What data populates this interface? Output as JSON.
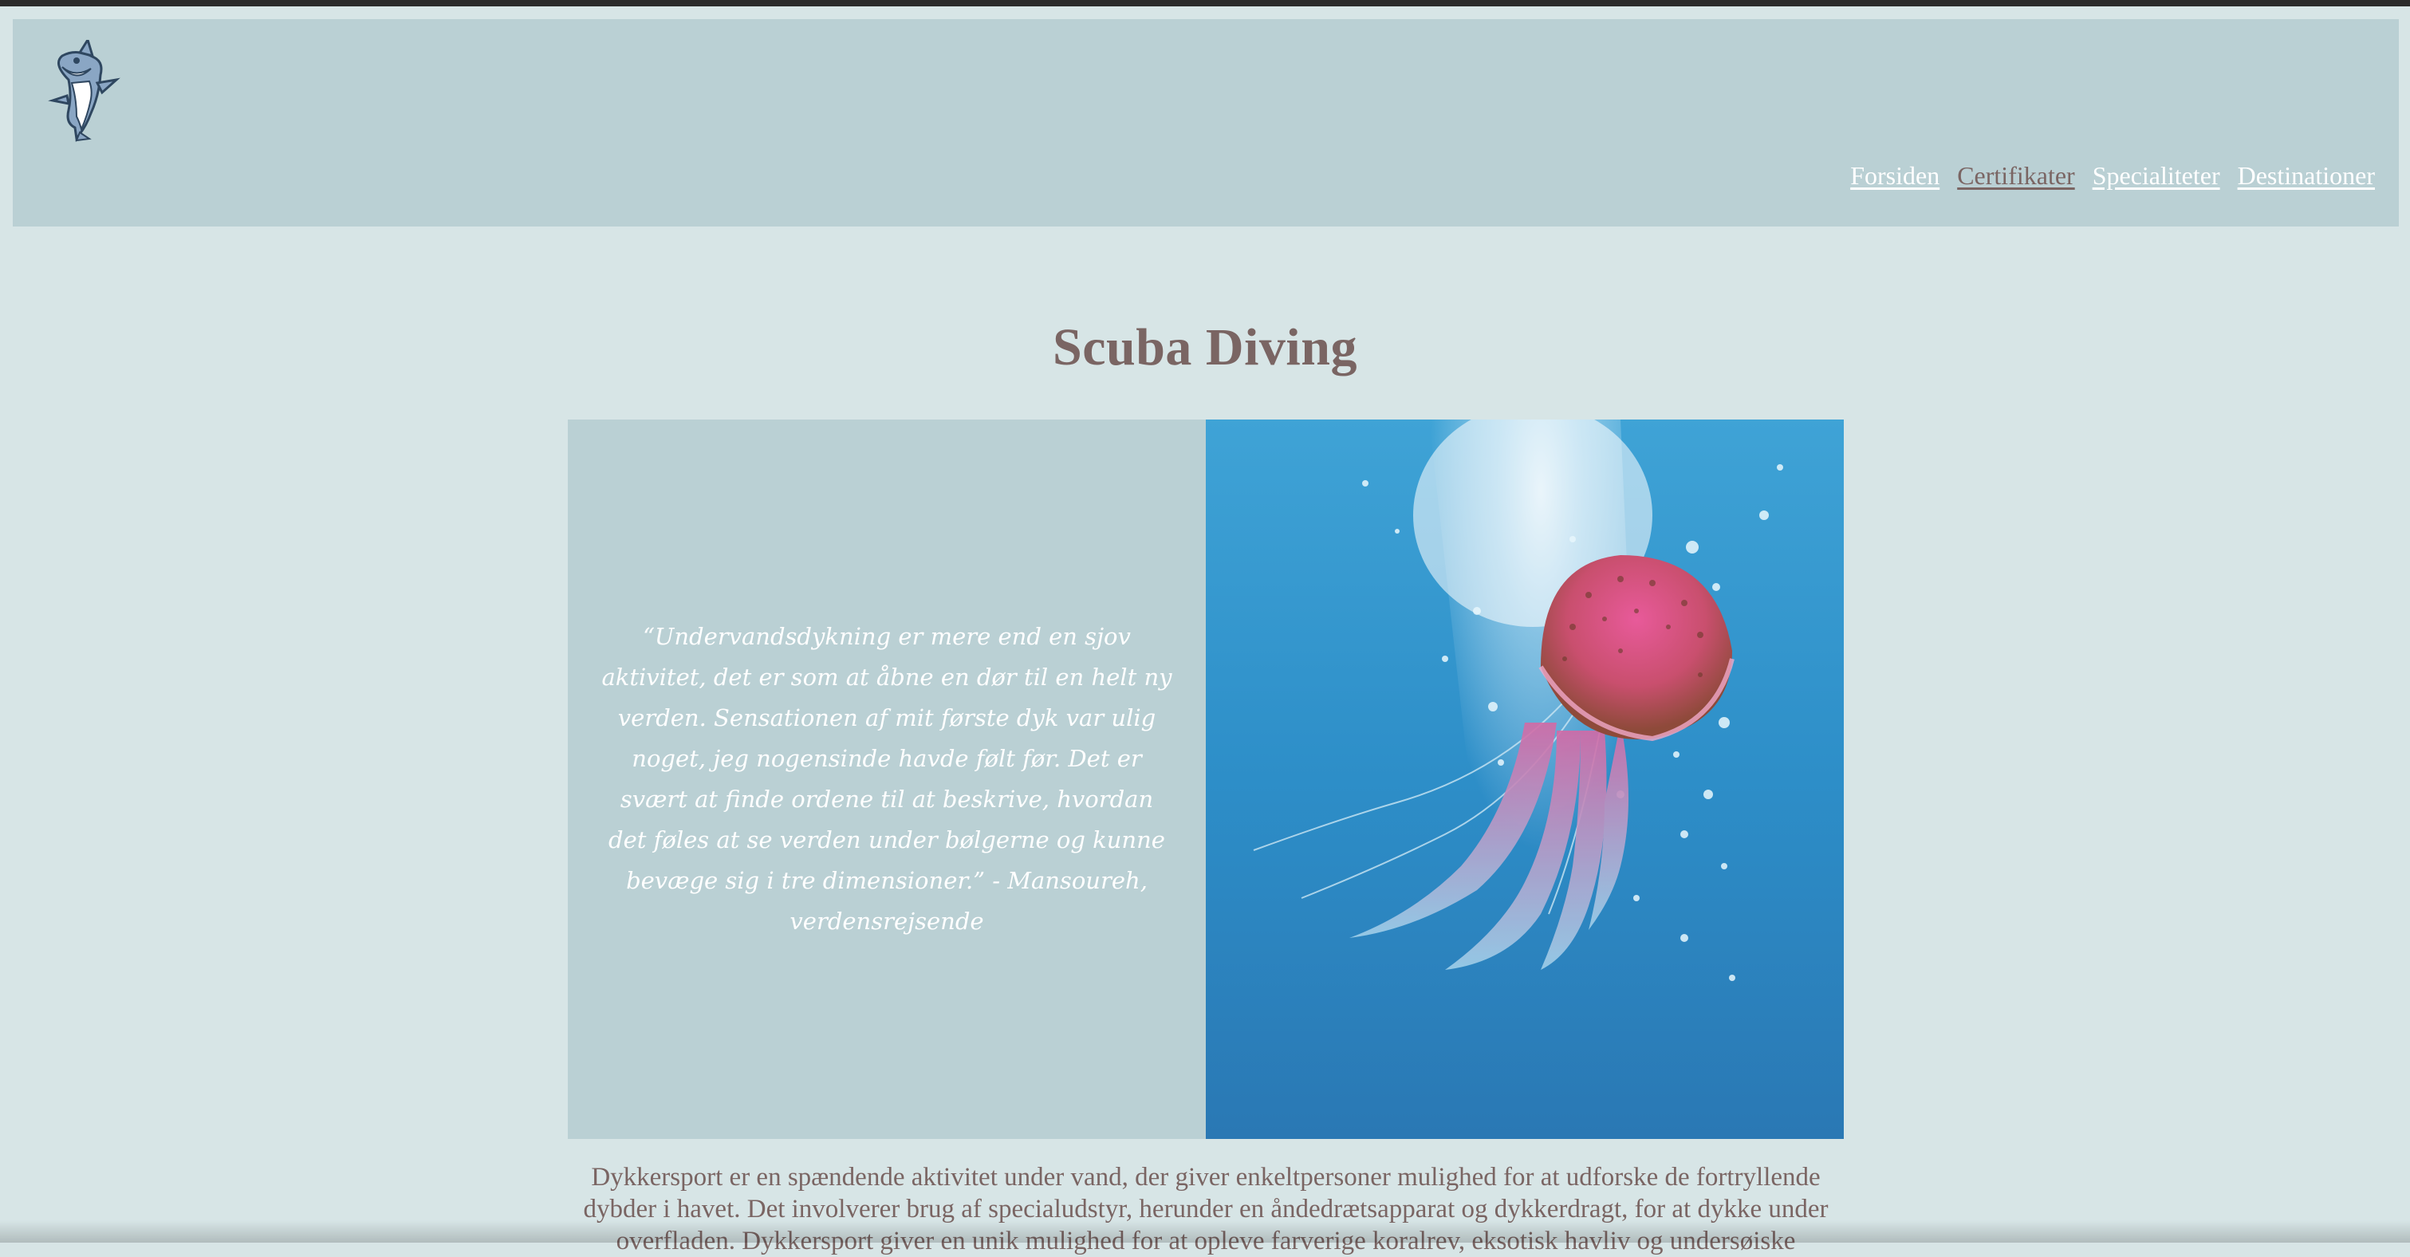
{
  "header": {
    "logo_icon": "shark-mascot-icon",
    "nav": [
      {
        "label": "Forsiden",
        "active": false
      },
      {
        "label": "Certifikater",
        "active": true
      },
      {
        "label": "Specialiteter",
        "active": false
      },
      {
        "label": "Destinationer",
        "active": false
      }
    ]
  },
  "main": {
    "title": "Scuba Diving",
    "quote": "“Undervandsdykning er mere end en sjov aktivitet, det er som at åbne en dør til en helt ny verden. Sensationen af mit første dyk var ulig noget, jeg nogensinde havde følt før. Det er svært at finde ordene til at beskrive, hvordan det føles at se verden under bølgerne og kunne bevæge sig i tre dimensioner.” - Mansoureh, verdensrejsende",
    "photo_icon": "jellyfish-underwater-photo",
    "body": "Dykkersport er en spændende aktivitet under vand, der giver enkeltpersoner mulighed for at udforske de fortryllende dybder i havet. Det involverer brug af specialudstyr, herunder en åndedrætsapparat og dykkerdragt, for at dykke under overfladen. Dykkersport giver en unik mulighed for at opleve farverige koralrev, eksotisk havliv og undersøiske"
  },
  "colors": {
    "page_bg": "#d7e5e6",
    "panel_bg": "#bad0d4",
    "text_brown": "#7a6563",
    "white": "#ffffff"
  }
}
